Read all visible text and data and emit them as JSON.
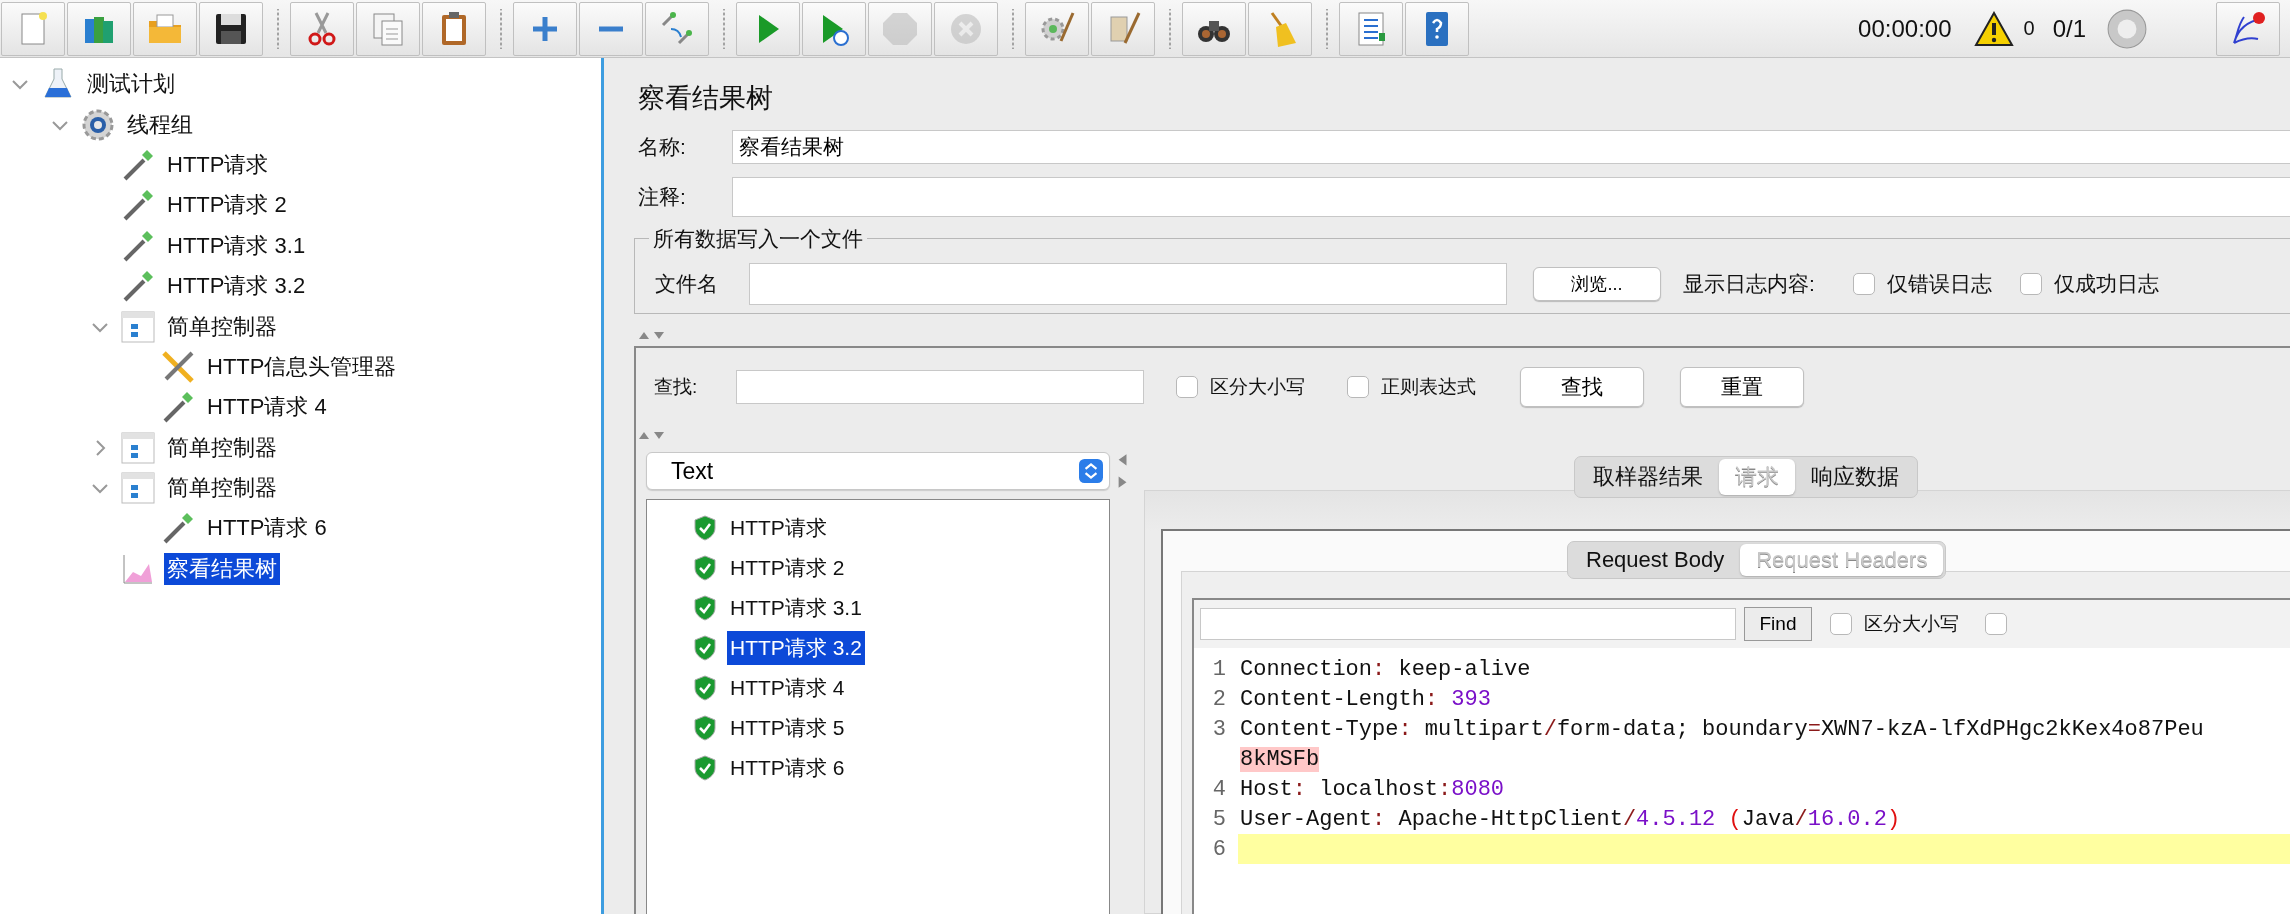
{
  "toolbar": {
    "groups": [
      [
        {
          "kind": "new",
          "disabled": false
        },
        {
          "kind": "templates",
          "disabled": false
        },
        {
          "kind": "open",
          "disabled": false
        },
        {
          "kind": "save",
          "disabled": false
        }
      ],
      [
        {
          "kind": "cut",
          "disabled": false
        },
        {
          "kind": "copy",
          "disabled": false
        },
        {
          "kind": "paste",
          "disabled": false
        }
      ],
      [
        {
          "kind": "expand",
          "disabled": false
        },
        {
          "kind": "collapse",
          "disabled": false
        },
        {
          "kind": "toggle",
          "disabled": false
        }
      ],
      [
        {
          "kind": "start",
          "disabled": false
        },
        {
          "kind": "start-no-pause",
          "disabled": false
        },
        {
          "kind": "stop",
          "disabled": true
        },
        {
          "kind": "shutdown",
          "disabled": true
        }
      ],
      [
        {
          "kind": "clear",
          "disabled": false
        },
        {
          "kind": "clear-all",
          "disabled": false
        }
      ],
      [
        {
          "kind": "search",
          "disabled": false
        },
        {
          "kind": "reset-search",
          "disabled": false
        }
      ],
      [
        {
          "kind": "functions",
          "disabled": false
        },
        {
          "kind": "help",
          "disabled": false
        }
      ]
    ],
    "timer": "00:00:00",
    "warnings": "0",
    "threads": "0/1"
  },
  "tree": [
    {
      "label": "测试计划",
      "kind": "plan",
      "expanded": true,
      "selected": false,
      "children": [
        {
          "label": "线程组",
          "kind": "threadgroup",
          "expanded": true,
          "selected": false,
          "children": [
            {
              "label": "HTTP请求",
              "kind": "sampler",
              "selected": false
            },
            {
              "label": "HTTP请求 2",
              "kind": "sampler",
              "selected": false
            },
            {
              "label": "HTTP请求 3.1",
              "kind": "sampler",
              "selected": false
            },
            {
              "label": "HTTP请求 3.2",
              "kind": "sampler",
              "selected": false
            },
            {
              "label": "简单控制器",
              "kind": "controller",
              "expanded": true,
              "selected": false,
              "children": [
                {
                  "label": "HTTP信息头管理器",
                  "kind": "config",
                  "selected": false
                },
                {
                  "label": "HTTP请求 4",
                  "kind": "sampler",
                  "selected": false
                }
              ]
            },
            {
              "label": "简单控制器",
              "kind": "controller",
              "expanded": false,
              "selected": false
            },
            {
              "label": "简单控制器",
              "kind": "controller",
              "expanded": true,
              "selected": false,
              "children": [
                {
                  "label": "HTTP请求 6",
                  "kind": "sampler",
                  "selected": false
                }
              ]
            },
            {
              "label": "察看结果树",
              "kind": "listener",
              "selected": true
            }
          ]
        }
      ]
    }
  ],
  "panel": {
    "title": "察看结果树",
    "name_label": "名称:",
    "name_value": "察看结果树",
    "comment_label": "注释:",
    "file_group": {
      "legend": "所有数据写入一个文件",
      "file_label": "文件名",
      "browse_button": "浏览...",
      "log_label": "显示日志内容:",
      "options": [
        {
          "label": "仅错误日志",
          "checked": false
        },
        {
          "label": "仅成功日志",
          "checked": false
        }
      ]
    }
  },
  "search": {
    "label": "查找:",
    "options": [
      {
        "label": "区分大小写",
        "checked": false
      },
      {
        "label": "正则表达式",
        "checked": false
      }
    ],
    "buttons": [
      "查找",
      "重置"
    ]
  },
  "renderer": {
    "value": "Text"
  },
  "results": [
    {
      "label": "HTTP请求",
      "selected": false
    },
    {
      "label": "HTTP请求 2",
      "selected": false
    },
    {
      "label": "HTTP请求 3.1",
      "selected": false
    },
    {
      "label": "HTTP请求 3.2",
      "selected": true
    },
    {
      "label": "HTTP请求 4",
      "selected": false
    },
    {
      "label": "HTTP请求 5",
      "selected": false
    },
    {
      "label": "HTTP请求 6",
      "selected": false
    }
  ],
  "tabs": [
    {
      "label": "取样器结果",
      "selected": false
    },
    {
      "label": "请求",
      "selected": true
    },
    {
      "label": "响应数据",
      "selected": false
    }
  ],
  "sub_tabs": [
    {
      "label": "Request Body",
      "selected": false
    },
    {
      "label": "Request Headers",
      "selected": true
    }
  ],
  "find": {
    "button": "Find",
    "options": [
      {
        "label": "区分大小写",
        "checked": false
      },
      {
        "checked": false
      }
    ]
  },
  "code_lines": [
    {
      "number": "1",
      "current": false,
      "segments": [
        {
          "text": "Connection",
          "kind": "key"
        },
        {
          "text": ":",
          "kind": "punct"
        },
        {
          "text": " keep-alive",
          "kind": "plain"
        }
      ]
    },
    {
      "number": "2",
      "current": false,
      "segments": [
        {
          "text": "Content-Length",
          "kind": "key"
        },
        {
          "text": ":",
          "kind": "punct"
        },
        {
          "text": " 393",
          "kind": "number"
        }
      ]
    },
    {
      "number": "3",
      "current": false,
      "segments": [
        {
          "text": "Content-Type",
          "kind": "key"
        },
        {
          "text": ":",
          "kind": "punct"
        },
        {
          "text": " multipart",
          "kind": "plain"
        },
        {
          "text": "/",
          "kind": "punct"
        },
        {
          "text": "form-data; boundary",
          "kind": "plain"
        },
        {
          "text": "=",
          "kind": "punct"
        },
        {
          "text": "XWN7-kzA-lfXdPHgc2kKex4o87Peu",
          "kind": "plain"
        }
      ]
    },
    {
      "current": false,
      "segments": [
        {
          "text": "8kMSFb",
          "kind": "error"
        }
      ]
    },
    {
      "number": "4",
      "current": false,
      "segments": [
        {
          "text": "Host",
          "kind": "key"
        },
        {
          "text": ":",
          "kind": "punct"
        },
        {
          "text": " localhost",
          "kind": "plain"
        },
        {
          "text": ":",
          "kind": "punct"
        },
        {
          "text": "8080",
          "kind": "number"
        }
      ]
    },
    {
      "number": "5",
      "current": false,
      "segments": [
        {
          "text": "User-Agent",
          "kind": "key"
        },
        {
          "text": ":",
          "kind": "punct"
        },
        {
          "text": " Apache-HttpClient",
          "kind": "plain"
        },
        {
          "text": "/",
          "kind": "punct"
        },
        {
          "text": "4.5.12",
          "kind": "number"
        },
        {
          "text": " (",
          "kind": "paren"
        },
        {
          "text": "Java",
          "kind": "plain"
        },
        {
          "text": "/",
          "kind": "punct"
        },
        {
          "text": "16.0.2",
          "kind": "number"
        },
        {
          "text": ")",
          "kind": "paren"
        }
      ]
    },
    {
      "number": "6",
      "current": true
    }
  ]
}
